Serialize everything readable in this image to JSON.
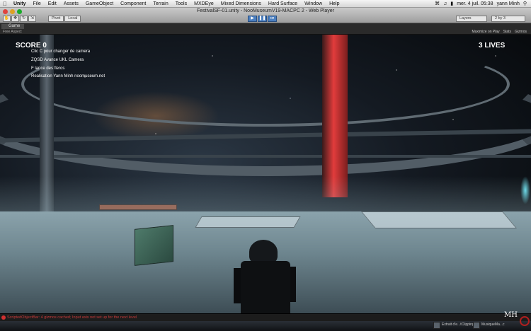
{
  "menubar": {
    "app": "Unity",
    "items": [
      "File",
      "Edit",
      "Assets",
      "GameObject",
      "Component",
      "Terrain",
      "Tools",
      "MXDEye",
      "Mixed Dimensions",
      "Hard Surface",
      "Window",
      "Help"
    ],
    "clock": "mer. 4 juil.  05:38",
    "user": "yann Minh"
  },
  "window": {
    "title": "FestivalSF-01.unity - NooMuseumV19-MACPC 2 - Web Player",
    "pivot_label": "Pivot",
    "local_label": "Local",
    "layers_label": "Layers",
    "layout_label": "2 by 3"
  },
  "game_tab": {
    "label": "Game",
    "aspect": "Free Aspect",
    "maximize_label": "Maximize on Play",
    "stats_label": "Stats",
    "gizmos_label": "Gizmos"
  },
  "hud": {
    "score": "SCORE 0",
    "lives": "3 LIVES",
    "lines": [
      "Clic C pour changer de camera",
      "ZQSD Avance UKL Camera",
      "F lance des fleros",
      "Realisation Yann Minh  noomuseum.net"
    ]
  },
  "status": {
    "message": "ScriptedObjectBar: 4 gizmos cached; Input axis not set up for the next level"
  },
  "dock": {
    "items": [
      "Extrait d'e...tClipping",
      "MusiqueMa...c"
    ]
  },
  "logo_text": "MH",
  "colors": {
    "accent_red": "#e23c3c",
    "hud_text": "#ffffff",
    "error_red": "#c73a3a"
  }
}
